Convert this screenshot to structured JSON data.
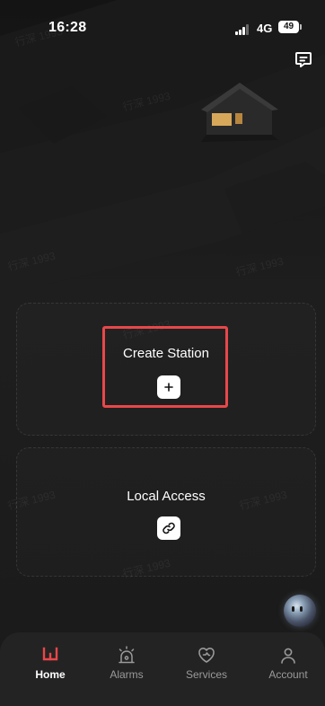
{
  "status_bar": {
    "time": "16:28",
    "network": "4G",
    "battery": "49"
  },
  "header": {
    "message_icon": "message-square-icon"
  },
  "watermark": "行深 1993",
  "cards": {
    "create_station": {
      "title": "Create Station",
      "button_icon": "plus-icon"
    },
    "local_access": {
      "title": "Local Access",
      "button_icon": "link-icon"
    }
  },
  "highlight_color": "#e8474a",
  "accent_color": "#e8474a",
  "tabs": [
    {
      "label": "Home",
      "icon": "home-logo-icon",
      "active": true
    },
    {
      "label": "Alarms",
      "icon": "alarm-siren-icon",
      "active": false
    },
    {
      "label": "Services",
      "icon": "heart-services-icon",
      "active": false
    },
    {
      "label": "Account",
      "icon": "user-icon",
      "active": false
    }
  ],
  "assistant": {
    "icon": "assistant-orb-icon"
  }
}
